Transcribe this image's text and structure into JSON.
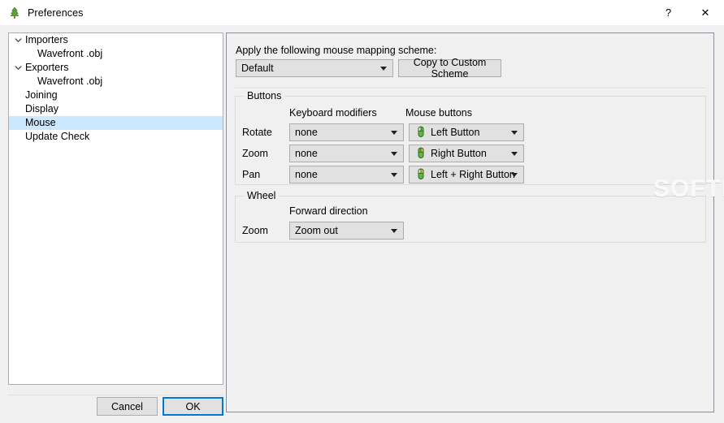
{
  "window": {
    "title": "Preferences",
    "icon": "tree-plant-icon",
    "controls": {
      "help_label": "?",
      "close_label": "✕"
    }
  },
  "sidebar": {
    "items": [
      {
        "label": "Importers",
        "level": 0,
        "expandable": true,
        "expanded": true,
        "selected": false
      },
      {
        "label": "Wavefront .obj",
        "level": 1,
        "expandable": false,
        "expanded": false,
        "selected": false
      },
      {
        "label": "Exporters",
        "level": 0,
        "expandable": true,
        "expanded": true,
        "selected": false
      },
      {
        "label": "Wavefront .obj",
        "level": 1,
        "expandable": false,
        "expanded": false,
        "selected": false
      },
      {
        "label": "Joining",
        "level": 0,
        "expandable": false,
        "expanded": false,
        "selected": false
      },
      {
        "label": "Display",
        "level": 0,
        "expandable": false,
        "expanded": false,
        "selected": false
      },
      {
        "label": "Mouse",
        "level": 0,
        "expandable": false,
        "expanded": false,
        "selected": true
      },
      {
        "label": "Update Check",
        "level": 0,
        "expandable": false,
        "expanded": false,
        "selected": false
      }
    ]
  },
  "footer": {
    "cancel_label": "Cancel",
    "ok_label": "OK"
  },
  "main": {
    "apply_label": "Apply the following mouse mapping scheme:",
    "scheme_value": "Default",
    "copy_button_label": "Copy to Custom Scheme",
    "buttons_group": {
      "title": "Buttons",
      "col_modifiers": "Keyboard modifiers",
      "col_mouse": "Mouse buttons",
      "rows": [
        {
          "label": "Rotate",
          "modifier": "none",
          "mouse": "Left Button",
          "mouse_icon": "mouse-left-icon"
        },
        {
          "label": "Zoom",
          "modifier": "none",
          "mouse": "Right Button",
          "mouse_icon": "mouse-right-icon"
        },
        {
          "label": "Pan",
          "modifier": "none",
          "mouse": "Left + Right Button",
          "mouse_icon": "mouse-both-icon"
        }
      ]
    },
    "wheel_group": {
      "title": "Wheel",
      "col_forward": "Forward direction",
      "rows": [
        {
          "label": "Zoom",
          "direction": "Zoom out"
        }
      ]
    }
  },
  "watermark": {
    "text": "SOFTPEDIA",
    "mark": "®"
  },
  "colors": {
    "accent": "#0078d7",
    "selection": "#cce8ff",
    "window_bg": "#f0f0f0",
    "panel_bg": "#ffffff",
    "control_bg": "#e1e1e1",
    "border": "#acacac",
    "mouse_icon_green": "#4a9a3f"
  }
}
